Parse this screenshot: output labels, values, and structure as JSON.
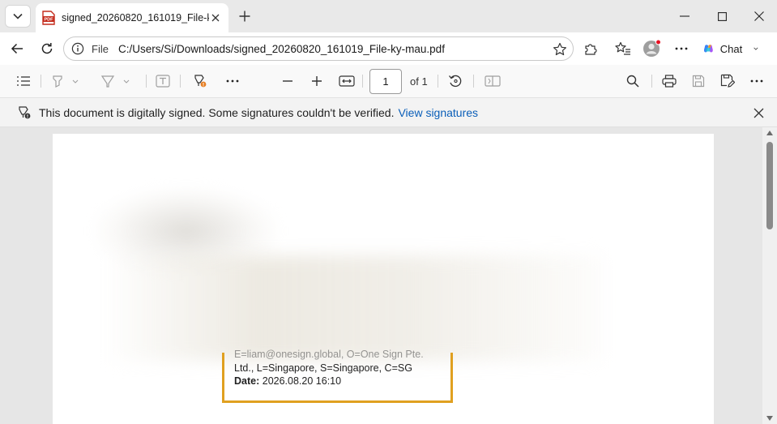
{
  "tab": {
    "title": "signed_20260820_161019_File-ky-mau.pdf",
    "favicon_label": "PDF",
    "favicon": "pdf-file-icon"
  },
  "address": {
    "scheme_label": "File",
    "url": "C:/Users/Si/Downloads/signed_20260820_161019_File-ky-mau.pdf"
  },
  "chat": {
    "label": "Chat"
  },
  "pdf_toolbar": {
    "page_number": "1",
    "page_count": "of 1"
  },
  "infobar": {
    "message": "This document is digitally signed. Some signatures couldn't be verified.",
    "link": "View signatures"
  },
  "signature": {
    "line_partial": "E=liam@onesign.global, O=One Sign Pte.",
    "line_2": "Ltd., L=Singapore, S=Singapore, C=SG",
    "date_label": "Date:",
    "date_value": "2026.08.20 16:10"
  },
  "colors": {
    "accent_link": "#0a5eb8",
    "signature_border": "#e0a020",
    "profile_badge": "#e81123"
  }
}
